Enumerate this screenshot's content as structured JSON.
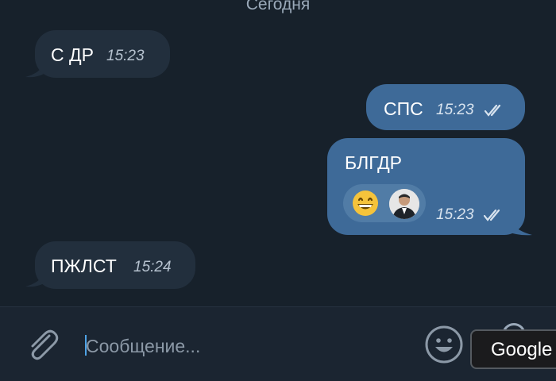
{
  "chat": {
    "date_label": "Сегодня",
    "messages": [
      {
        "direction": "incoming",
        "text": "С ДР",
        "time": "15:23"
      },
      {
        "direction": "outgoing",
        "text": "СПС",
        "time": "15:23",
        "status": "read"
      },
      {
        "direction": "outgoing",
        "text": "БЛГДР",
        "time": "15:23",
        "status": "read",
        "reaction": {
          "emoji": "😄",
          "reactor": "avatar-photo"
        }
      },
      {
        "direction": "incoming",
        "text": "ПЖЛСТ",
        "time": "15:24"
      }
    ]
  },
  "composer": {
    "placeholder": "Сообщение...",
    "value": "",
    "attach_icon": "paperclip-icon",
    "emoji_icon": "smiley-icon"
  },
  "tooltip": {
    "text": "Google"
  },
  "colors": {
    "background": "#17212b",
    "incoming_bubble": "#222f3d",
    "outgoing_bubble": "#3e6a98",
    "accent": "#4fa3e6"
  }
}
